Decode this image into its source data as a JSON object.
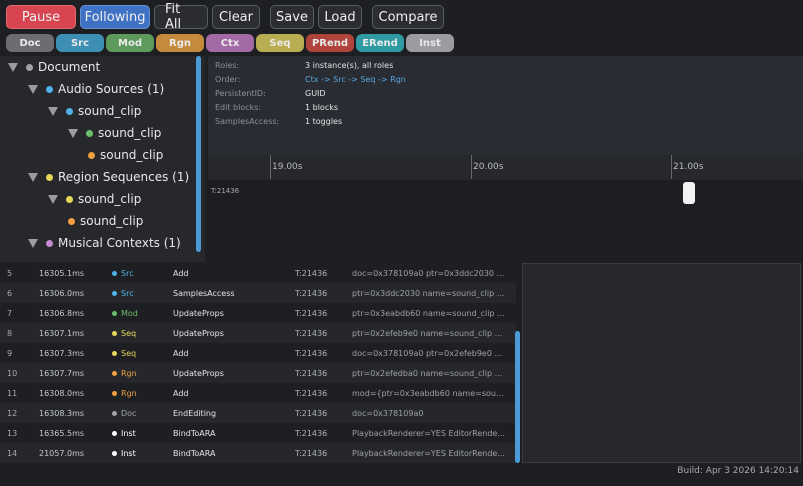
{
  "toolbar": {
    "pause": "Pause",
    "following": "Following",
    "fit_all": "Fit All",
    "clear": "Clear",
    "save": "Save",
    "load": "Load",
    "compare": "Compare"
  },
  "chips": [
    {
      "label": "Doc",
      "color": "#6b6d72"
    },
    {
      "label": "Src",
      "color": "#3d8fb4"
    },
    {
      "label": "Mod",
      "color": "#5e9a5c"
    },
    {
      "label": "Rgn",
      "color": "#c58a3e"
    },
    {
      "label": "Ctx",
      "color": "#a46aa6"
    },
    {
      "label": "Seq",
      "color": "#b9ad52"
    },
    {
      "label": "PRend",
      "color": "#b0443c"
    },
    {
      "label": "ERend",
      "color": "#2f9aa2"
    },
    {
      "label": "Inst",
      "color": "#9b9ca0"
    }
  ],
  "tree": [
    {
      "label": "Document",
      "dot": "#a0a2a6"
    },
    {
      "label": "Audio Sources (1)",
      "dot": "#4fb3e8"
    },
    {
      "label": "sound_clip",
      "dot": "#4fb3e8"
    },
    {
      "label": "sound_clip",
      "dot": "#6cbf6a"
    },
    {
      "label": "sound_clip",
      "dot": "#f0a040"
    },
    {
      "label": "Region Sequences (1)",
      "dot": "#e8d85a"
    },
    {
      "label": "sound_clip",
      "dot": "#e8d85a"
    },
    {
      "label": "sound_clip",
      "dot": "#f0a040"
    },
    {
      "label": "Musical Contexts (1)",
      "dot": "#c88ad0"
    }
  ],
  "details": [
    {
      "label": "Roles:",
      "value": "3 instance(s), all roles"
    },
    {
      "label": "Order:",
      "value": "Ctx -> Src -> Seq -> Rgn"
    },
    {
      "label": "PersistentID:",
      "value": "GUID"
    },
    {
      "label": "Edit blocks:",
      "value": "1 blocks"
    },
    {
      "label": "SamplesAccess:",
      "value": "1 toggles"
    }
  ],
  "timeline": {
    "ticks": [
      "19.00s",
      "20.00s",
      "21.00s"
    ],
    "lane_label": "T:21436"
  },
  "log": [
    {
      "n": "5",
      "t": "16305.1ms",
      "cat": "Src",
      "cat_color": "#4fb3e8",
      "op": "Add",
      "thr": "T:21436",
      "detail": "doc=0x378109a0 ptr=0x3ddc2030 ..."
    },
    {
      "n": "6",
      "t": "16306.0ms",
      "cat": "Src",
      "cat_color": "#4fb3e8",
      "op": "SamplesAccess",
      "thr": "T:21436",
      "detail": "ptr=0x3ddc2030 name=sound_clip ..."
    },
    {
      "n": "7",
      "t": "16306.8ms",
      "cat": "Mod",
      "cat_color": "#6cbf6a",
      "op": "UpdateProps",
      "thr": "T:21436",
      "detail": "ptr=0x3eabdb60 name=sound_clip ..."
    },
    {
      "n": "8",
      "t": "16307.1ms",
      "cat": "Seq",
      "cat_color": "#e8d85a",
      "op": "UpdateProps",
      "thr": "T:21436",
      "detail": "ptr=0x2efeb9e0 name=sound_clip ..."
    },
    {
      "n": "9",
      "t": "16307.3ms",
      "cat": "Seq",
      "cat_color": "#e8d85a",
      "op": "Add",
      "thr": "T:21436",
      "detail": "doc=0x378109a0 ptr=0x2efeb9e0 ..."
    },
    {
      "n": "10",
      "t": "16307.7ms",
      "cat": "Rgn",
      "cat_color": "#f0a040",
      "op": "UpdateProps",
      "thr": "T:21436",
      "detail": "ptr=0x2efedba0 name=sound_clip ..."
    },
    {
      "n": "11",
      "t": "16308.0ms",
      "cat": "Rgn",
      "cat_color": "#f0a040",
      "op": "Add",
      "thr": "T:21436",
      "detail": "mod={ptr=0x3eabdb60 name=sou..."
    },
    {
      "n": "12",
      "t": "16308.3ms",
      "cat": "Doc",
      "cat_color": "#a0a2a6",
      "op": "EndEditing",
      "thr": "T:21436",
      "detail": "doc=0x378109a0"
    },
    {
      "n": "13",
      "t": "16365.5ms",
      "cat": "Inst",
      "cat_color": "#ffffff",
      "op": "BindToARA",
      "thr": "T:21436",
      "detail": "PlaybackRenderer=YES EditorRende..."
    },
    {
      "n": "14",
      "t": "21057.0ms",
      "cat": "Inst",
      "cat_color": "#ffffff",
      "op": "BindToARA",
      "thr": "T:21436",
      "detail": "PlaybackRenderer=YES EditorRende..."
    }
  ],
  "status": "Build: Apr  3 2026 14:20:14"
}
